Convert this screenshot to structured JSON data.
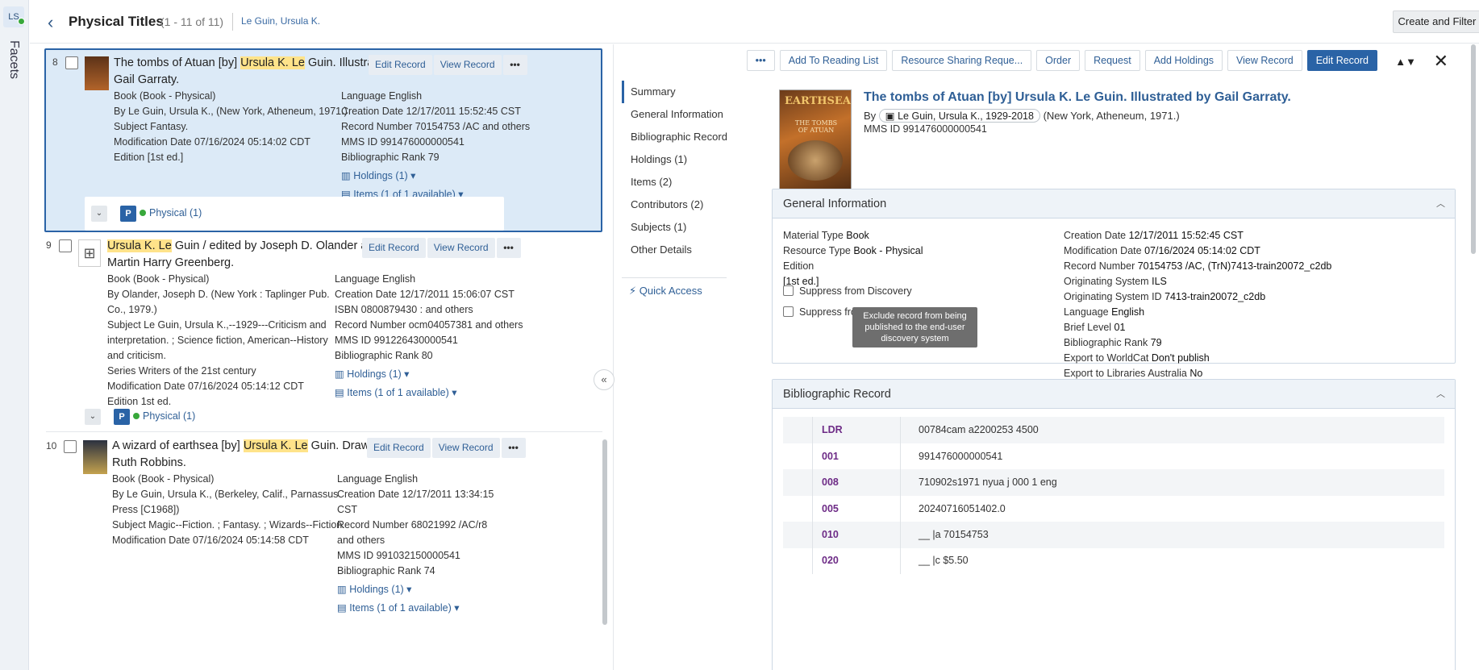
{
  "rail": {
    "badge": "LS",
    "facets_label": "Facets"
  },
  "header": {
    "title": "Physical Titles",
    "count": "(1 - 11 of 11)",
    "search_term": "Le Guin, Ursula K.",
    "create_filter_label": "Create and Filter Set"
  },
  "list": {
    "edit_label": "Edit Record",
    "view_label": "View Record",
    "more_label": "•••",
    "records": [
      {
        "num": "8",
        "title_pre": "The tombs of Atuan [by] ",
        "title_hl1": "Ursula K. Le",
        "title_post": " Guin. Illustrated by Gail Garraty.",
        "left": [
          "Book (Book - Physical)",
          "By Le Guin, Ursula K., (New York, Atheneum, 1971.)",
          "Subject Fantasy.",
          "Modification Date 07/16/2024 05:14:02 CDT",
          "Edition [1st ed.]"
        ],
        "right": [
          "Language English",
          "Creation Date 12/17/2011 15:52:45 CST",
          "Record Number 70154753 /AC and others",
          "MMS ID 991476000000541",
          "Bibliographic Rank 79"
        ],
        "holdings": "Holdings (1)",
        "items": "Items (1 of 1 available)",
        "physical": "Physical (1)"
      },
      {
        "num": "9",
        "title_hl1": "Ursula K. Le",
        "title_post": " Guin / edited by Joseph D. Olander and Martin Harry Greenberg.",
        "left": [
          "Book (Book - Physical)",
          "By Olander, Joseph D. (New York : Taplinger Pub. Co., 1979.)",
          "Subject Le Guin, Ursula K.,--1929---Criticism and interpretation. ; Science fiction, American--History and criticism.",
          "Series Writers of the 21st century",
          "Modification Date 07/16/2024 05:14:12 CDT",
          "Edition 1st ed."
        ],
        "right": [
          "Language English",
          "Creation Date 12/17/2011 15:06:07 CST",
          "ISBN 0800879430 : and others",
          "Record Number ocm04057381 and others",
          "MMS ID 991226430000541",
          "Bibliographic Rank 80"
        ],
        "holdings": "Holdings (1)",
        "items": "Items (1 of 1 available)",
        "physical": "Physical (1)"
      },
      {
        "num": "10",
        "title_pre": "A wizard of earthsea [by] ",
        "title_hl1": "Ursula K. Le",
        "title_post": " Guin. Drawings by Ruth Robbins.",
        "left": [
          "Book (Book - Physical)",
          "By Le Guin, Ursula K., (Berkeley, Calif., Parnassus Press [C1968])",
          "Subject Magic--Fiction. ; Fantasy. ; Wizards--Fiction.",
          "Modification Date 07/16/2024 05:14:58 CDT"
        ],
        "right": [
          "Language English",
          "Creation Date 12/17/2011 13:34:15 CST",
          "Record Number 68021992 /AC/r8 and others",
          "MMS ID 991032150000541",
          "Bibliographic Rank 74"
        ],
        "holdings": "Holdings (1)",
        "items": "Items (1 of 1 available)"
      }
    ]
  },
  "toolbar": {
    "more": "•••",
    "buttons": [
      "Add To Reading List",
      "Resource Sharing Reque...",
      "Order",
      "Request",
      "Add Holdings",
      "View Record"
    ],
    "primary": "Edit Record",
    "arrows": "▲▼",
    "close": "✕"
  },
  "side_nav": {
    "items": [
      "Summary",
      "General Information",
      "Bibliographic Record",
      "Holdings (1)",
      "Items (2)",
      "Contributors (2)",
      "Subjects (1)",
      "Other Details"
    ],
    "quick_access": "Quick Access"
  },
  "detail": {
    "cover_title": "EARTHSEA",
    "cover_subtitle": "THE TOMBS OF ATUAN",
    "title": "The tombs of Atuan [by] Ursula K. Le Guin. Illustrated by Gail Garraty.",
    "by_label": "By",
    "author": "Le Guin, Ursula K., 1929-2018",
    "imprint": "(New York, Atheneum, 1971.)",
    "mms": "MMS ID 991476000000541"
  },
  "general_info": {
    "heading": "General Information",
    "left": [
      {
        "k": "Material Type",
        "v": "Book"
      },
      {
        "k": "Resource Type",
        "v": "Book - Physical"
      },
      {
        "k": "Edition",
        "v": ""
      },
      {
        "k": "",
        "v": "[1st ed.]"
      }
    ],
    "suppress_discovery": "Suppress from Discovery",
    "suppress_external": "Suppress from External Search",
    "tooltip": "Exclude record from being published to the end-user discovery system",
    "right": [
      {
        "k": "Creation Date",
        "v": "12/17/2011 15:52:45 CST"
      },
      {
        "k": "Modification Date",
        "v": "07/16/2024 05:14:02 CDT"
      },
      {
        "k": "Record Number",
        "v": "70154753 /AC, (TrN)7413-train20072_c2db"
      },
      {
        "k": "Originating System",
        "v": "ILS"
      },
      {
        "k": "Originating System ID",
        "v": "7413-train20072_c2db"
      },
      {
        "k": "Language",
        "v": "English"
      },
      {
        "k": "Brief Level",
        "v": "01"
      },
      {
        "k": "Bibliographic Rank",
        "v": "79"
      },
      {
        "k": "Export to WorldCat",
        "v": "Don't publish"
      },
      {
        "k": "Export to Libraries Australia",
        "v": "No"
      }
    ]
  },
  "bib_record": {
    "heading": "Bibliographic Record",
    "rows": [
      {
        "tag": "LDR",
        "val": "00784cam a2200253 4500"
      },
      {
        "tag": "001",
        "val": "991476000000541"
      },
      {
        "tag": "008",
        "val": "710902s1971 nyua j 000 1 eng"
      },
      {
        "tag": "005",
        "val": "20240716051402.0"
      },
      {
        "tag": "010",
        "val": "__ |a 70154753"
      },
      {
        "tag": "020",
        "val": "__ |c $5.50"
      }
    ]
  }
}
